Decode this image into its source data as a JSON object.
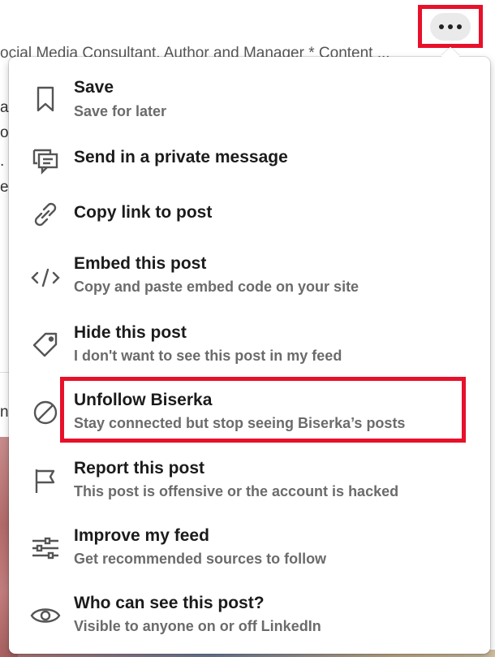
{
  "background": {
    "author_headline": "ocial Media Consultant. Author and Manager * Content ...",
    "fragments": [
      "a",
      "o",
      ".",
      "er",
      "ne"
    ]
  },
  "more_button": {
    "icon": "more-horizontal-icon"
  },
  "menu": {
    "items": [
      {
        "icon": "bookmark-icon",
        "title": "Save",
        "subtitle": "Save for later"
      },
      {
        "icon": "message-icon",
        "title": "Send in a private message",
        "subtitle": ""
      },
      {
        "icon": "link-icon",
        "title": "Copy link to post",
        "subtitle": ""
      },
      {
        "icon": "code-icon",
        "title": "Embed this post",
        "subtitle": "Copy and paste embed code on your site"
      },
      {
        "icon": "tag-icon",
        "title": "Hide this post",
        "subtitle": "I don't want to see this post in my feed"
      },
      {
        "icon": "block-icon",
        "title": "Unfollow Biserka",
        "subtitle": "Stay connected but stop seeing Biserka’s posts"
      },
      {
        "icon": "flag-icon",
        "title": "Report this post",
        "subtitle": "This post is offensive or the account is hacked"
      },
      {
        "icon": "sliders-icon",
        "title": "Improve my feed",
        "subtitle": "Get recommended sources to follow"
      },
      {
        "icon": "eye-icon",
        "title": "Who can see this post?",
        "subtitle": "Visible to anyone on or off LinkedIn"
      }
    ]
  },
  "colors": {
    "highlight": "#e8102a",
    "title": "#1b1b1b",
    "subtitle": "#6b6b6b"
  }
}
